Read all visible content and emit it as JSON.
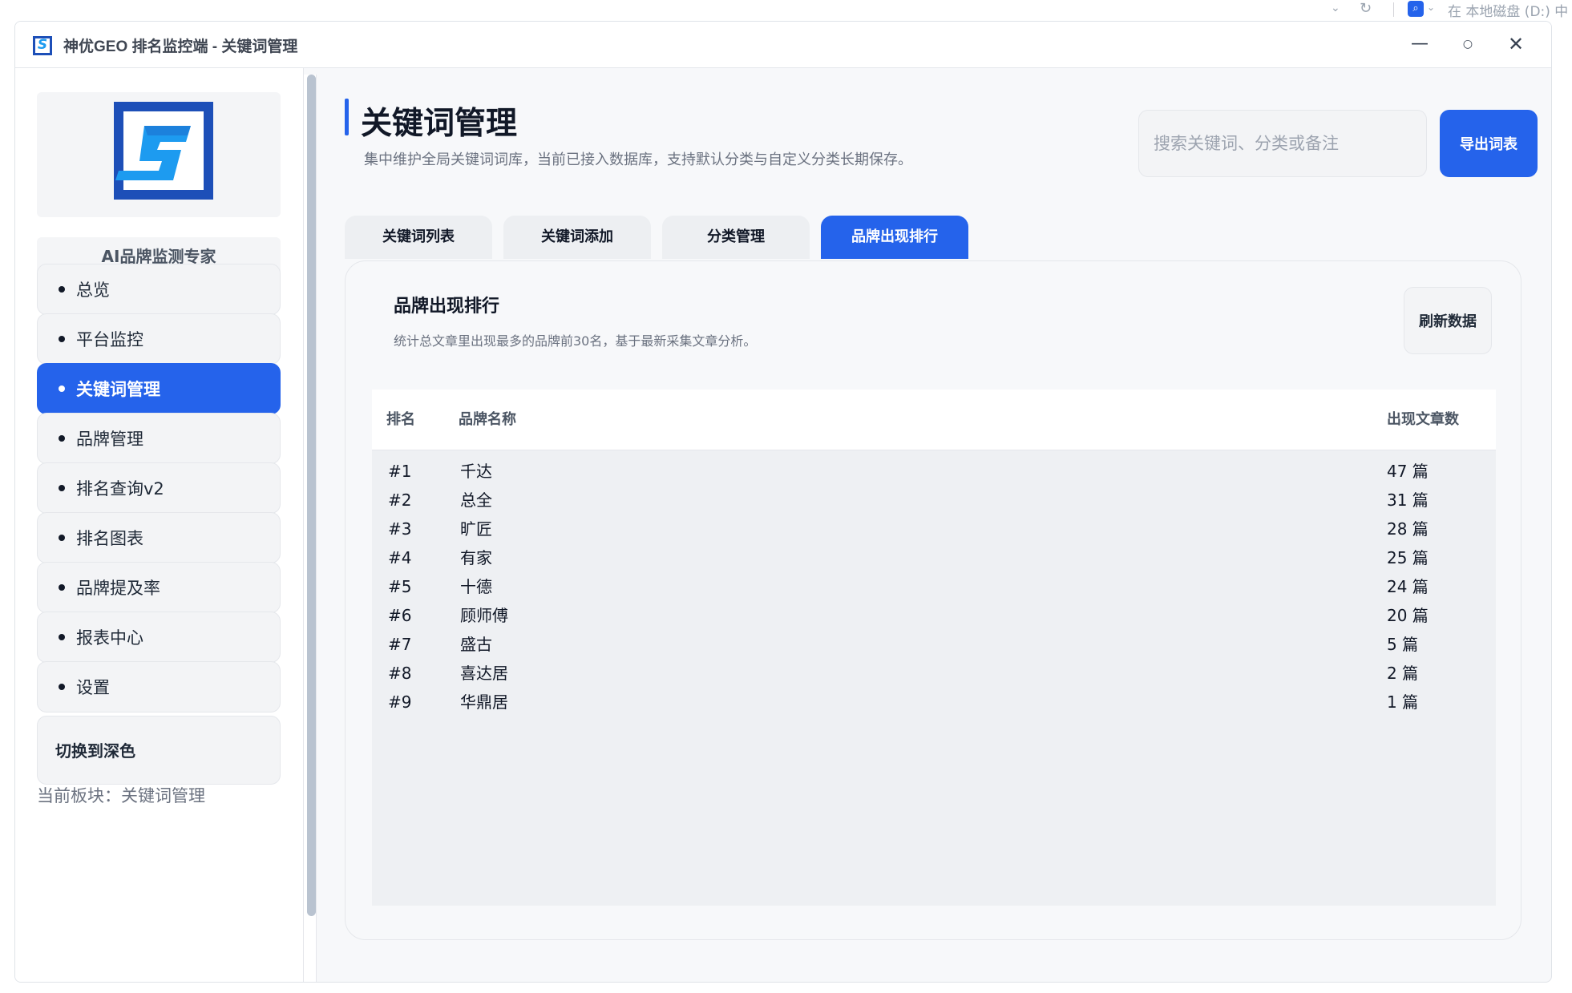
{
  "background": {
    "path_text": "在 本地磁盘 (D:) 中"
  },
  "window": {
    "title": "神优GEO 排名监控端 - 关键词管理",
    "min_glyph": "—",
    "max_glyph": "○",
    "close_glyph": "✕"
  },
  "sidebar": {
    "logo_letter": "S",
    "brand_tag": "AI品牌监测专家",
    "items": [
      {
        "label": "总览"
      },
      {
        "label": "平台监控"
      },
      {
        "label": "关键词管理"
      },
      {
        "label": "品牌管理"
      },
      {
        "label": "排名查询v2"
      },
      {
        "label": "排名图表"
      },
      {
        "label": "品牌提及率"
      },
      {
        "label": "报表中心"
      },
      {
        "label": "设置"
      }
    ],
    "active_item": "关键词管理",
    "theme_button": "切换到深色",
    "status": "当前板块：关键词管理"
  },
  "header": {
    "title": "关键词管理",
    "subtitle": "集中维护全局关键词词库，当前已接入数据库，支持默认分类与自定义分类长期保存。",
    "search_placeholder": "搜索关键词、分类或备注",
    "export_label": "导出词表"
  },
  "tabs": [
    {
      "label": "关键词列表"
    },
    {
      "label": "关键词添加"
    },
    {
      "label": "分类管理"
    },
    {
      "label": "品牌出现排行"
    }
  ],
  "active_tab": "品牌出现排行",
  "panel": {
    "title": "品牌出现排行",
    "description": "统计总文章里出现最多的品牌前30名，基于最新采集文章分析。",
    "refresh_label": "刷新数据",
    "columns": [
      "排名",
      "品牌名称",
      "出现文章数"
    ],
    "rows": [
      {
        "rank": "#1",
        "name": "千达",
        "count": "47 篇"
      },
      {
        "rank": "#2",
        "name": "总全",
        "count": "31 篇"
      },
      {
        "rank": "#3",
        "name": "旷匠",
        "count": "28 篇"
      },
      {
        "rank": "#4",
        "name": "有家",
        "count": "25 篇"
      },
      {
        "rank": "#5",
        "name": "十德",
        "count": "24 篇"
      },
      {
        "rank": "#6",
        "name": "顾师傅",
        "count": "20 篇"
      },
      {
        "rank": "#7",
        "name": "盛古",
        "count": "5 篇"
      },
      {
        "rank": "#8",
        "name": "喜达居",
        "count": "2 篇"
      },
      {
        "rank": "#9",
        "name": "华鼎居",
        "count": "1 篇"
      }
    ]
  },
  "colors": {
    "accent": "#2563eb",
    "logo_dark": "#1d4fb8",
    "logo_light": "#1d9bf0"
  }
}
